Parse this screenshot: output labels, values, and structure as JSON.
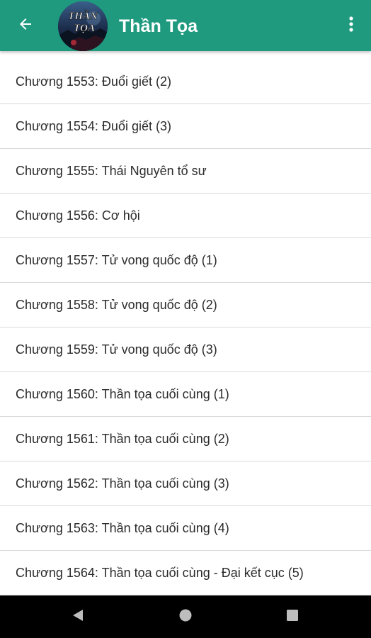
{
  "app_bar": {
    "title": "Thần Tọa",
    "back_icon": "arrow-left-icon",
    "menu_icon": "more-vertical-icon",
    "background_color": "#1f9a7f",
    "avatar": {
      "title_line1": "THẦN",
      "title_line2": "TỌA"
    }
  },
  "chapters": [
    {
      "label": "Chương 1553: Đuổi giết (2)"
    },
    {
      "label": "Chương 1554: Đuổi giết (3)"
    },
    {
      "label": "Chương 1555: Thái Nguyên tổ sư"
    },
    {
      "label": "Chương 1556: Cơ hội"
    },
    {
      "label": "Chương 1557: Tử vong quốc độ (1)"
    },
    {
      "label": "Chương 1558: Tử vong quốc độ (2)"
    },
    {
      "label": "Chương 1559: Tử vong quốc độ (3)"
    },
    {
      "label": "Chương 1560: Thần tọa cuối cùng (1)"
    },
    {
      "label": "Chương 1561: Thần tọa cuối cùng (2)"
    },
    {
      "label": "Chương 1562: Thần tọa cuối cùng (3)"
    },
    {
      "label": "Chương 1563: Thần tọa cuối cùng (4)"
    },
    {
      "label": "Chương 1564: Thần tọa cuối cùng - Đại kết cục (5)"
    }
  ],
  "nav_bar": {
    "back_icon": "nav-back-triangle-icon",
    "home_icon": "nav-home-circle-icon",
    "recents_icon": "nav-recents-square-icon"
  }
}
